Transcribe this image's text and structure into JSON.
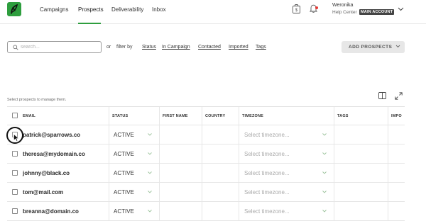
{
  "nav": {
    "items": [
      {
        "label": "Campaigns"
      },
      {
        "label": "Prospects",
        "active": true
      },
      {
        "label": "Deliverability"
      },
      {
        "label": "Inbox"
      }
    ],
    "accent": "#2e9e3e"
  },
  "user": {
    "name": "Weronika",
    "org": "Help Center",
    "badge": "MAIN ACCOUNT"
  },
  "toolbar": {
    "search_placeholder": "search...",
    "or_text": "or",
    "filter_by": "filter by",
    "filters": [
      "Status",
      "In Campaign",
      "Contacted",
      "Imported",
      "Tags"
    ],
    "add_button": "ADD PROSPECTS"
  },
  "hint": "Select prospects to manage them.",
  "table": {
    "columns": [
      "EMAIL",
      "STATUS",
      "FIRST NAME",
      "COUNTRY",
      "TIMEZONE",
      "TAGS",
      "IMPO"
    ],
    "rows": [
      {
        "email": "patrick@sparrows.co",
        "status": "ACTIVE",
        "timezone": "Select timezone..."
      },
      {
        "email": "theresa@mydomain.co",
        "status": "ACTIVE",
        "timezone": "Select timezone..."
      },
      {
        "email": "johnny@black.co",
        "status": "ACTIVE",
        "timezone": "Select timezone..."
      },
      {
        "email": "tom@mail.com",
        "status": "ACTIVE",
        "timezone": "Select timezone..."
      },
      {
        "email": "breanna@domain.co",
        "status": "ACTIVE",
        "timezone": "Select timezone..."
      }
    ]
  }
}
